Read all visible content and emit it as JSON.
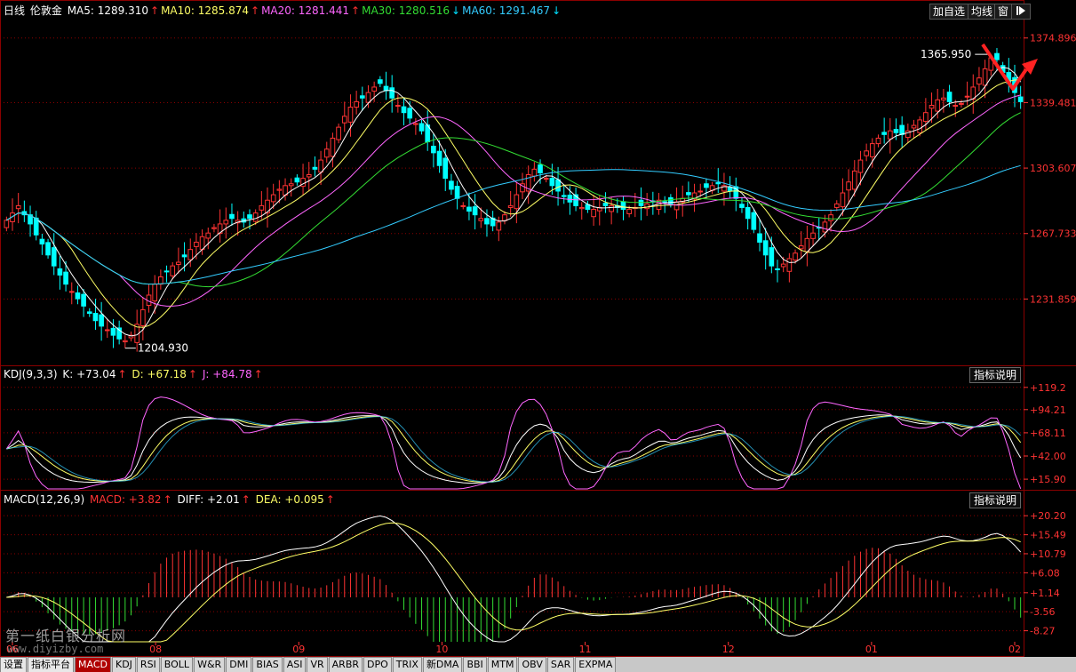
{
  "header": {
    "period": "日线",
    "symbol": "伦敦金",
    "ma": [
      {
        "label": "MA5:",
        "value": "1289.310",
        "arrow": "↑",
        "color": "#ffffff"
      },
      {
        "label": "MA10:",
        "value": "1285.874",
        "arrow": "↑",
        "color": "#ffff66"
      },
      {
        "label": "MA20:",
        "value": "1281.441",
        "arrow": "↑",
        "color": "#ff66ff"
      },
      {
        "label": "MA30:",
        "value": "1280.516",
        "arrow": "↓",
        "color": "#33dd33"
      },
      {
        "label": "MA60:",
        "value": "1291.467",
        "arrow": "↓",
        "color": "#33ccff"
      }
    ]
  },
  "toolbar": {
    "add_watch": "加自选",
    "ma_line": "均线",
    "window": "窗",
    "nav_icon": "arrow-right-icon"
  },
  "kdj_header": {
    "name": "KDJ(9,3,3)",
    "k": "K: +73.04",
    "k_arrow": "↑",
    "d": "D: +67.18",
    "d_arrow": "↑",
    "j": "J: +84.78",
    "j_arrow": "↑"
  },
  "macd_header": {
    "name": "MACD(12,26,9)",
    "macd": "MACD: +3.82",
    "macd_arrow": "↑",
    "diff": "DIFF: +2.01",
    "diff_arrow": "↑",
    "dea": "DEA: +0.095",
    "dea_arrow": "↑"
  },
  "indicator_button": "指标说明",
  "watermark": {
    "line1": "第一纸白银分析网",
    "line2": "www.diyizby.com"
  },
  "tabs": {
    "tools": [
      "设置",
      "指标平台"
    ],
    "indicators": [
      "MACD",
      "KDJ",
      "RSI",
      "BOLL",
      "W&R",
      "DMI",
      "BIAS",
      "ASI",
      "VR",
      "ARBR",
      "DPO",
      "TRIX",
      "新DMA",
      "BBI",
      "MTM",
      "OBV",
      "SAR",
      "EXPMA"
    ],
    "active": "MACD"
  },
  "colors": {
    "up": "#ff3333",
    "down": "#00ffff",
    "ma5": "#ffffff",
    "ma10": "#ffff66",
    "ma20": "#ff66ff",
    "ma30": "#33dd33",
    "ma60": "#33ccff",
    "grid": "#8b0000"
  },
  "chart_data": [
    {
      "type": "candlestick",
      "title": "伦敦金",
      "x_ticks": [
        "06",
        "08",
        "09",
        "10",
        "11",
        "12",
        "01",
        "02"
      ],
      "y_ticks": [
        "1374.896",
        "1339.481",
        "1303.607",
        "1267.733",
        "1231.859"
      ],
      "ylim": [
        1196,
        1385
      ],
      "annotations": [
        {
          "text": "1365.950",
          "kind": "high",
          "value": 1365.95
        },
        {
          "text": "1204.930",
          "kind": "low",
          "value": 1204.93
        }
      ],
      "closes": [
        1275,
        1279,
        1283,
        1278,
        1273,
        1267,
        1262,
        1256,
        1250,
        1245,
        1240,
        1236,
        1232,
        1228,
        1224,
        1220,
        1217,
        1215,
        1212,
        1210,
        1209,
        1212,
        1218,
        1226,
        1234,
        1240,
        1244,
        1247,
        1250,
        1252,
        1255,
        1259,
        1263,
        1266,
        1268,
        1271,
        1273,
        1275,
        1276,
        1275,
        1274,
        1276,
        1279,
        1283,
        1286,
        1289,
        1292,
        1294,
        1295,
        1296,
        1298,
        1300,
        1303,
        1308,
        1314,
        1320,
        1326,
        1332,
        1337,
        1340,
        1342,
        1345,
        1348,
        1350,
        1346,
        1342,
        1338,
        1334,
        1331,
        1328,
        1324,
        1318,
        1312,
        1305,
        1298,
        1292,
        1287,
        1283,
        1280,
        1278,
        1276,
        1273,
        1272,
        1274,
        1278,
        1283,
        1289,
        1295,
        1300,
        1303,
        1301,
        1298,
        1294,
        1291,
        1288,
        1285,
        1283,
        1282,
        1281,
        1281,
        1282,
        1283,
        1283,
        1282,
        1281,
        1281,
        1282,
        1283,
        1284,
        1285,
        1286,
        1285,
        1284,
        1285,
        1287,
        1289,
        1290,
        1291,
        1293,
        1294,
        1295,
        1294,
        1291,
        1287,
        1282,
        1276,
        1270,
        1263,
        1256,
        1250,
        1248,
        1251,
        1254,
        1257,
        1261,
        1265,
        1268,
        1271,
        1274,
        1278,
        1284,
        1290,
        1296,
        1302,
        1308,
        1313,
        1317,
        1320,
        1322,
        1324,
        1323,
        1322,
        1324,
        1327,
        1330,
        1334,
        1338,
        1341,
        1342,
        1340,
        1338,
        1339,
        1343,
        1348,
        1353,
        1358,
        1364,
        1363,
        1356,
        1350,
        1345,
        1340
      ],
      "ma5_last": 1289.31,
      "ma10_last": 1285.874,
      "ma20_last": 1281.441,
      "ma30_last": 1280.516,
      "ma60_last": 1291.467
    },
    {
      "type": "line",
      "title": "KDJ(9,3,3)",
      "y_ticks": [
        "+119.2",
        "+94.21",
        "+68.11",
        "+42.00",
        "+15.90"
      ],
      "ylim": [
        5,
        125
      ],
      "series": [
        {
          "name": "K",
          "last": 73.04
        },
        {
          "name": "D",
          "last": 67.18
        },
        {
          "name": "J",
          "last": 84.78
        }
      ]
    },
    {
      "type": "bar",
      "title": "MACD(12,26,9)",
      "y_ticks": [
        "+20.20",
        "+15.49",
        "+10.79",
        "+6.08",
        "+1.14",
        "-3.56",
        "-8.27"
      ],
      "ylim": [
        -11,
        22
      ],
      "series": [
        {
          "name": "MACD",
          "last": 3.82
        },
        {
          "name": "DIFF",
          "last": 2.01
        },
        {
          "name": "DEA",
          "last": 0.095
        }
      ]
    }
  ]
}
